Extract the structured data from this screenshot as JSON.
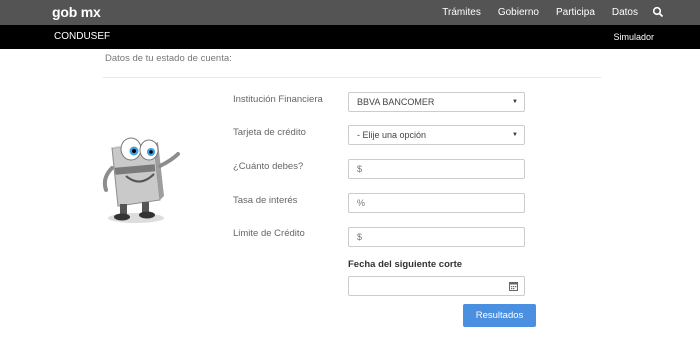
{
  "header": {
    "logo": "gob mx",
    "nav": [
      "Trámites",
      "Gobierno",
      "Participa",
      "Datos"
    ]
  },
  "subheader": {
    "brand": "CONDUSEF",
    "simulator": "Simulador"
  },
  "form": {
    "section_title": "Datos de tu estado de cuenta:",
    "fields": [
      {
        "label": "Institución Financiera",
        "value": "BBVA BANCOMER"
      },
      {
        "label": "Tarjeta de crédito",
        "value": "- Elije una opción"
      },
      {
        "label": "¿Cuánto debes?",
        "placeholder": "$"
      },
      {
        "label": "Tasa de interés",
        "placeholder": "%"
      },
      {
        "label": "Limite de Crédito",
        "placeholder": "$"
      }
    ],
    "fecha_label": "Fecha del siguiente corte",
    "submit": "Resultados"
  }
}
